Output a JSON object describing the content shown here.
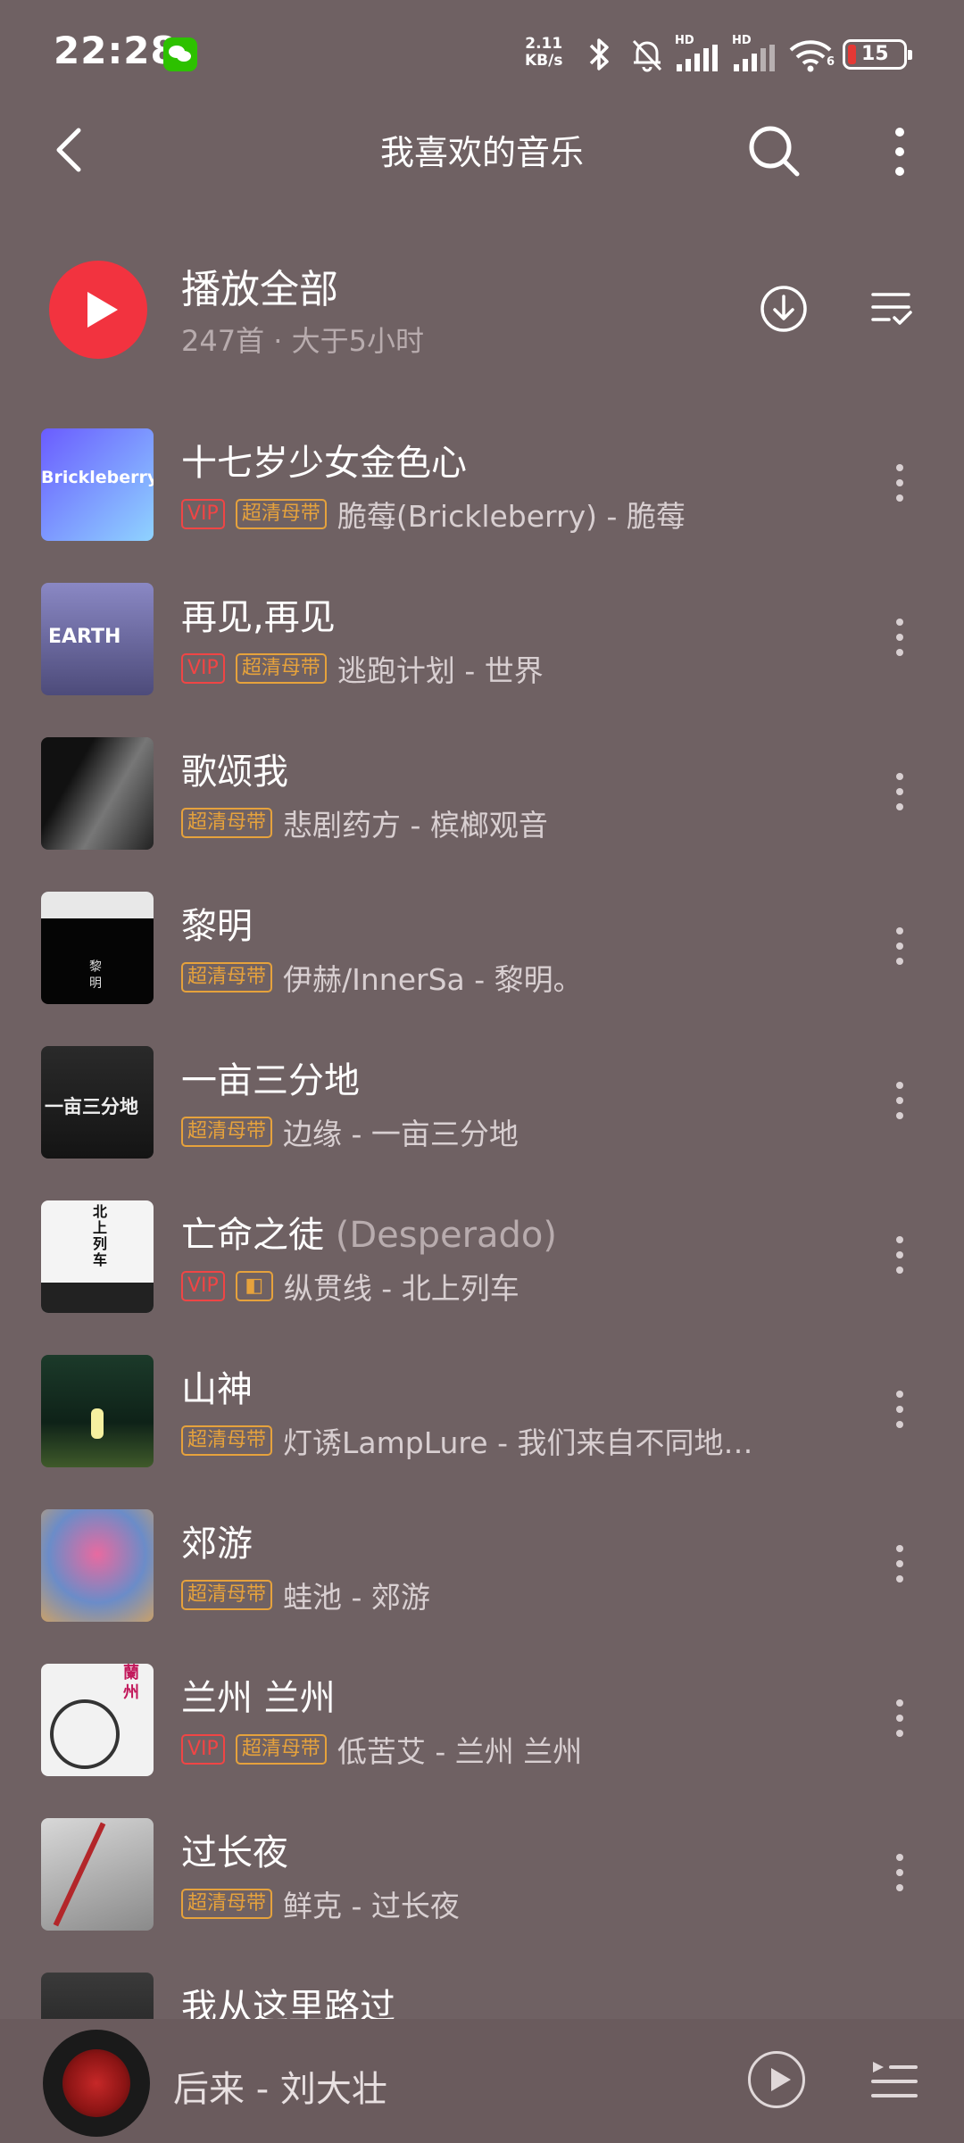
{
  "status_bar": {
    "time": "22:28",
    "net_speed": "2.11",
    "net_unit": "KB/s",
    "battery": "15",
    "signal_label_1": "HD",
    "signal_label_2": "HD",
    "wifi_label": "6"
  },
  "header": {
    "title": "我喜欢的音乐"
  },
  "play_all": {
    "label": "播放全部",
    "count": "247首 · 大于5小时"
  },
  "songs": [
    {
      "title": "十七岁少女金色心",
      "subtitle": "",
      "tags": [
        "VIP",
        "超清母带"
      ],
      "artist_album": "脆莓(Brickleberry) - 脆莓",
      "cover_text": "Brickleberry"
    },
    {
      "title": "再见,再见",
      "subtitle": "",
      "tags": [
        "VIP",
        "超清母带"
      ],
      "artist_album": "逃跑计划 - 世界",
      "cover_text": "EARTH"
    },
    {
      "title": "歌颂我",
      "subtitle": "",
      "tags": [
        "超清母带"
      ],
      "artist_album": "悲剧药方 - 槟榔观音",
      "cover_text": ""
    },
    {
      "title": "黎明",
      "subtitle": "",
      "tags": [
        "超清母带"
      ],
      "artist_album": "伊赫/InnerSa - 黎明。",
      "cover_text": "黎 明"
    },
    {
      "title": "一亩三分地",
      "subtitle": "",
      "tags": [
        "超清母带"
      ],
      "artist_album": "边缘 - 一亩三分地",
      "cover_text": "一亩三分地"
    },
    {
      "title": "亡命之徒",
      "subtitle": "(Desperado)",
      "tags": [
        "VIP",
        "dolby"
      ],
      "artist_album": "纵贯线 - 北上列车",
      "cover_text": "北上列车"
    },
    {
      "title": "山神",
      "subtitle": "",
      "tags": [
        "超清母带"
      ],
      "artist_album": "灯诱LampLure - 我们来自不同地…",
      "cover_text": ""
    },
    {
      "title": "郊游",
      "subtitle": "",
      "tags": [
        "超清母带"
      ],
      "artist_album": "蛙池 - 郊游",
      "cover_text": ""
    },
    {
      "title": "兰州 兰州",
      "subtitle": "",
      "tags": [
        "VIP",
        "超清母带"
      ],
      "artist_album": "低苦艾 - 兰州 兰州",
      "cover_text": "蘭州"
    },
    {
      "title": "过长夜",
      "subtitle": "",
      "tags": [
        "超清母带"
      ],
      "artist_album": "鲜克 - 过长夜",
      "cover_text": ""
    },
    {
      "title": "我从这里路过",
      "subtitle": "",
      "tags": [],
      "artist_album": "",
      "cover_text": ""
    }
  ],
  "player": {
    "now_playing": "后来 - 刘大壮"
  },
  "colors": {
    "background": "#6f6163",
    "accent": "#f2333f",
    "vip": "#f04545",
    "hq_tag": "#e6a23c"
  }
}
